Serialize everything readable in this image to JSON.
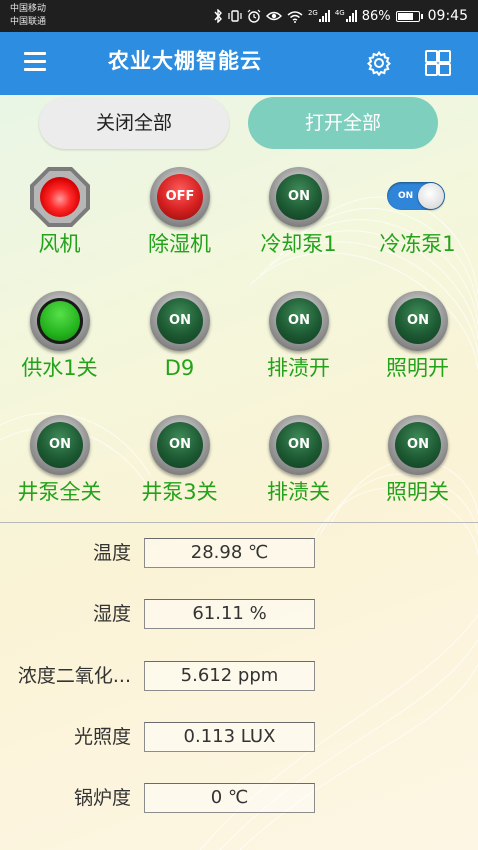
{
  "status_bar": {
    "carrier1": "中国移动",
    "carrier2": "中国联通",
    "net1": "2G",
    "net2": "4G",
    "battery": "86%",
    "battery_level": 0.86,
    "time": "09:45"
  },
  "app_bar": {
    "title": "农业大棚智能云"
  },
  "actions": {
    "close_all": "关闭全部",
    "open_all": "打开全部"
  },
  "devices": [
    {
      "label": "风机",
      "state": "red-led"
    },
    {
      "label": "除湿机",
      "state": "OFF"
    },
    {
      "label": "冷却泵1",
      "state": "ON"
    },
    {
      "label": "冷冻泵1",
      "state": "toggle",
      "toggle_text": "ON"
    },
    {
      "label": "供水1关",
      "state": "green-led"
    },
    {
      "label": "D9",
      "state": "ON"
    },
    {
      "label": "排渍开",
      "state": "ON"
    },
    {
      "label": "照明开",
      "state": "ON"
    },
    {
      "label": "井泵全关",
      "state": "ON"
    },
    {
      "label": "井泵3关",
      "state": "ON"
    },
    {
      "label": "排渍关",
      "state": "ON"
    },
    {
      "label": "照明关",
      "state": "ON"
    }
  ],
  "knob_text": {
    "on": "ON",
    "off": "OFF"
  },
  "readings": [
    {
      "label": "温度",
      "value": "28.98 ℃"
    },
    {
      "label": "湿度",
      "value": "61.11 %"
    },
    {
      "label": "浓度二氧化...",
      "value": "5.612 ppm"
    },
    {
      "label": "光照度",
      "value": "0.113 LUX"
    },
    {
      "label": "锅炉度",
      "value": "0 ℃"
    }
  ]
}
